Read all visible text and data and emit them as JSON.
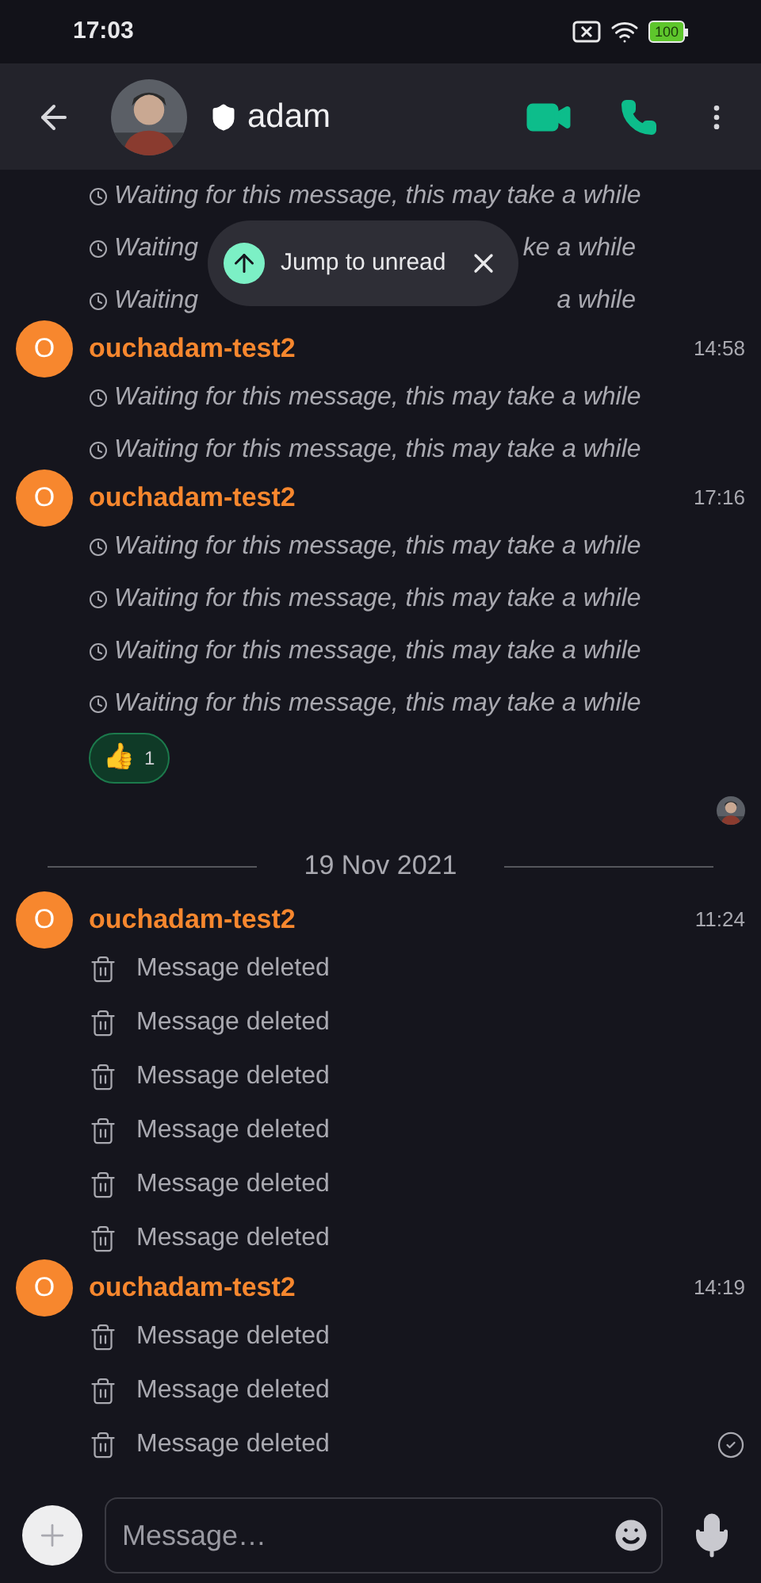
{
  "status_bar": {
    "time": "17:03",
    "battery": "100"
  },
  "header": {
    "title": "adam"
  },
  "jump_banner": {
    "label": "Jump to unread"
  },
  "timeline": [
    {
      "kind": "continuation",
      "sent": false,
      "lines": [
        {
          "kind": "waiting",
          "text": "Waiting for this message, this may take a while"
        },
        {
          "kind": "covered",
          "before": "Waiting",
          "after": "ke a while"
        },
        {
          "kind": "covered",
          "before": "Waiting",
          "after": "a while"
        }
      ]
    },
    {
      "kind": "group",
      "sender": "ouchadam-test2",
      "avatar_letter": "O",
      "time": "14:58",
      "sent": false,
      "lines": [
        {
          "kind": "waiting",
          "text": "Waiting for this message, this may take a while"
        },
        {
          "kind": "waiting",
          "text": "Waiting for this message, this may take a while"
        }
      ]
    },
    {
      "kind": "group",
      "sender": "ouchadam-test2",
      "avatar_letter": "O",
      "time": "17:16",
      "sent": false,
      "read_by_avatar": true,
      "lines": [
        {
          "kind": "waiting",
          "text": "Waiting for this message, this may take a while"
        },
        {
          "kind": "waiting",
          "text": "Waiting for this message, this may take a while"
        },
        {
          "kind": "waiting",
          "text": "Waiting for this message, this may take a while"
        },
        {
          "kind": "waiting",
          "text": "Waiting for this message, this may take a while"
        }
      ],
      "reaction": {
        "emoji": "👍",
        "count": "1",
        "selected": true
      }
    },
    {
      "kind": "date",
      "label": "19 Nov 2021"
    },
    {
      "kind": "group",
      "sender": "ouchadam-test2",
      "avatar_letter": "O",
      "time": "11:24",
      "sent": false,
      "lines": [
        {
          "kind": "deleted",
          "text": "Message deleted"
        },
        {
          "kind": "deleted",
          "text": "Message deleted"
        },
        {
          "kind": "deleted",
          "text": "Message deleted"
        },
        {
          "kind": "deleted",
          "text": "Message deleted"
        },
        {
          "kind": "deleted",
          "text": "Message deleted"
        },
        {
          "kind": "deleted",
          "text": "Message deleted"
        }
      ]
    },
    {
      "kind": "group",
      "sender": "ouchadam-test2",
      "avatar_letter": "O",
      "time": "14:19",
      "sent": true,
      "lines": [
        {
          "kind": "deleted",
          "text": "Message deleted"
        },
        {
          "kind": "deleted",
          "text": "Message deleted"
        },
        {
          "kind": "deleted",
          "text": "Message deleted"
        }
      ]
    }
  ],
  "composer": {
    "placeholder": "Message…"
  }
}
